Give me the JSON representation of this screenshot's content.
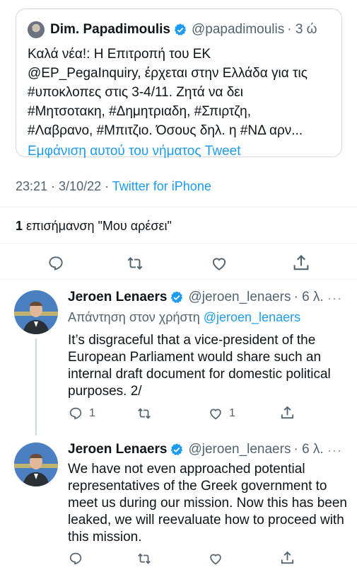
{
  "quoted_tweet": {
    "author_name": "Dim. Papadimoulis",
    "author_handle": "@papadimoulis",
    "time": "· 3 ώ",
    "lines": [
      "Καλά νέα!: Η Επιτροπή του ΕΚ",
      "@EP_PegaInquiry, έρχεται στην Ελλάδα για τις",
      "#υποκλοπες στις 3-4/11. Ζητά να δει",
      "#Μητσοτακη, #Δημητριαδη, #Σπιρτζη,",
      "#Λαβρανο, #Μπιτζιο. Όσους δηλ. η #ΝΔ αρν..."
    ],
    "show_tweet": "Εμφάνιση αυτού του νήματος Tweet"
  },
  "main_tweet": {
    "time": "23:21 · 3/10/22 · ",
    "source": "Twitter for iPhone",
    "likes_count": "1",
    "likes_label": " επισήμανση \"Μου αρέσει\""
  },
  "replies": [
    {
      "author_name": "Jeroen Lenaers",
      "author_handle": "@jeroen_lenaers",
      "time": "· 6 λ.",
      "more": "···",
      "replying_prefix": "Απάντηση στον χρήστη ",
      "replying_to": "@jeroen_lenaers",
      "text": "It’s disgraceful that a vice-president of the European Parliament would share such an internal draft document for domestic political purposes. 2/",
      "reply_count": "1",
      "retweet_count": "",
      "like_count": "1"
    },
    {
      "author_name": "Jeroen Lenaers",
      "author_handle": "@jeroen_lenaers",
      "time": "· 6 λ.",
      "more": "···",
      "text": "We have not even approached potential representatives of the Greek government to meet us during our mission. Now this has been leaked, we will reevaluate how to proceed with this mission.",
      "reply_count": "",
      "retweet_count": "",
      "like_count": ""
    }
  ],
  "colors": {
    "accent": "#1d9bf0",
    "muted": "#536471",
    "text": "#0f1419",
    "border": "#cfd9de"
  },
  "icons": [
    "verified-badge-icon",
    "reply-icon",
    "retweet-icon",
    "like-icon",
    "share-icon",
    "more-icon"
  ]
}
